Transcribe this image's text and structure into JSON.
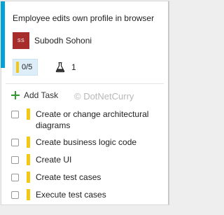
{
  "card": {
    "title": "Employee edits own profile in browser",
    "avatar_initials": "SS",
    "assignee": "Subodh Sohoni",
    "progress_text": "0/5",
    "test_count": "1",
    "add_task_label": "Add Task",
    "watermark": "© DotNetCurry",
    "accent_color": "#00a2d8",
    "task_color": "#f2c811"
  },
  "tasks": [
    {
      "label": "Create or change architectural diagrams"
    },
    {
      "label": "Create business logic code"
    },
    {
      "label": "Create UI"
    },
    {
      "label": "Create test cases"
    },
    {
      "label": "Execute test cases"
    }
  ]
}
